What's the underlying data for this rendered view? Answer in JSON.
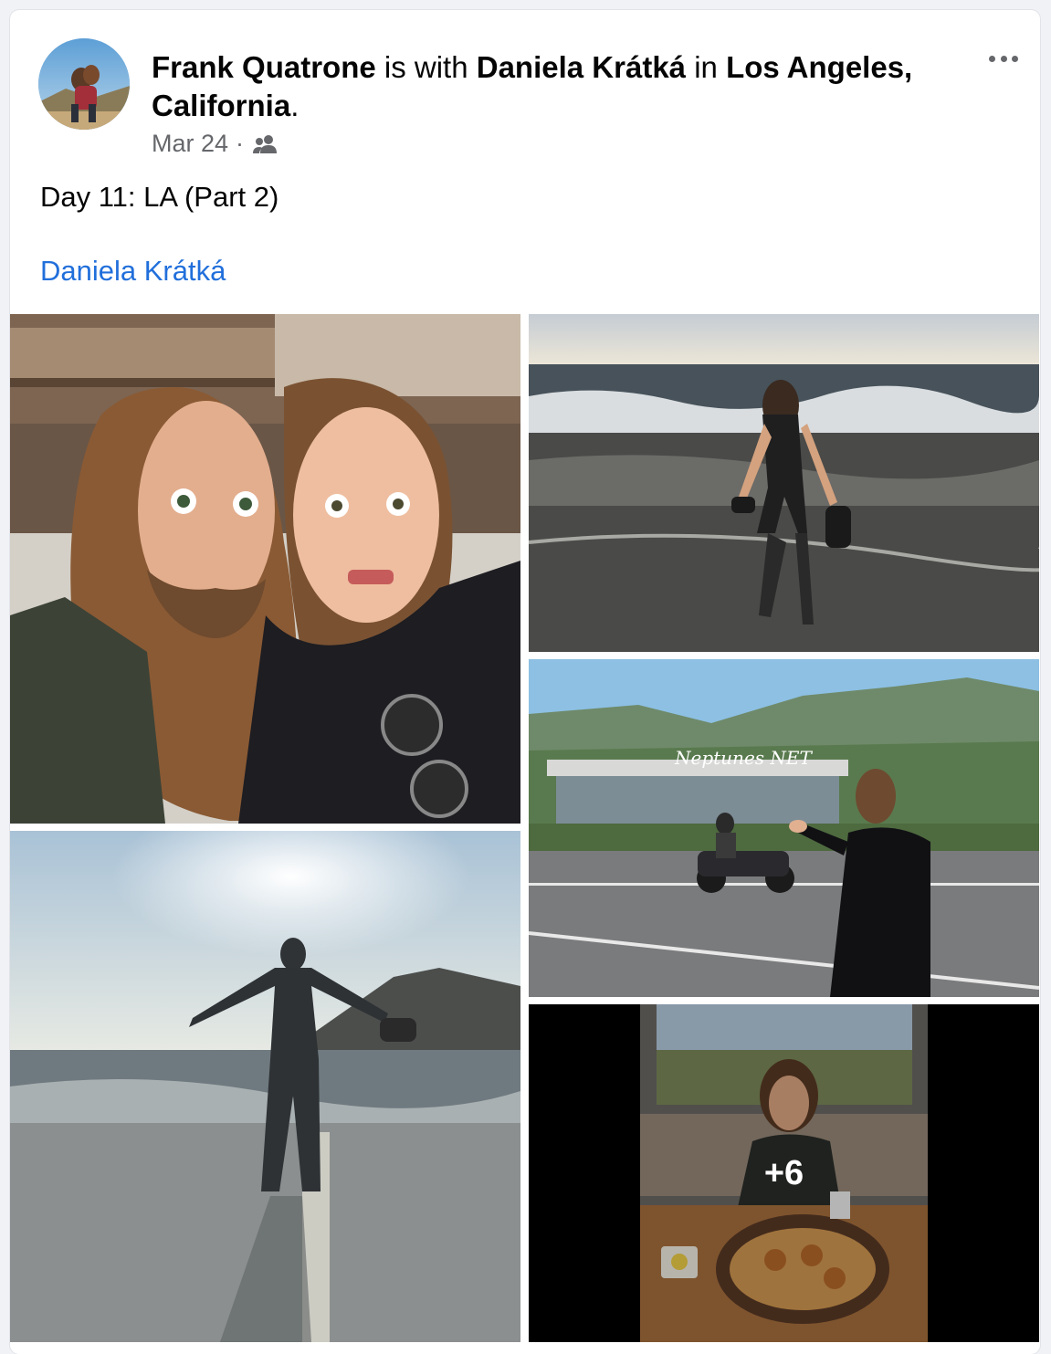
{
  "post": {
    "author": "Frank Quatrone",
    "with_text": "is with",
    "tagged": "Daniela Krátká",
    "in_text": "in",
    "location": "Los Angeles, California",
    "end_punct": ".",
    "date": "Mar 24",
    "separator": "·",
    "audience_icon": "friends-icon",
    "body": "Day 11: LA (Part 2)",
    "tag_link": "Daniela Krátká",
    "more_photos_label": "+6"
  },
  "photos": [
    {
      "name": "selfie-photo",
      "icon": "photo"
    },
    {
      "name": "beach-walk-photo",
      "icon": "photo"
    },
    {
      "name": "neptunes-net-photo",
      "icon": "photo"
    },
    {
      "name": "sunset-beach-photo",
      "icon": "photo"
    },
    {
      "name": "restaurant-photo",
      "icon": "photo"
    }
  ],
  "colors": {
    "link": "#216fdb",
    "meta": "#65676b"
  }
}
